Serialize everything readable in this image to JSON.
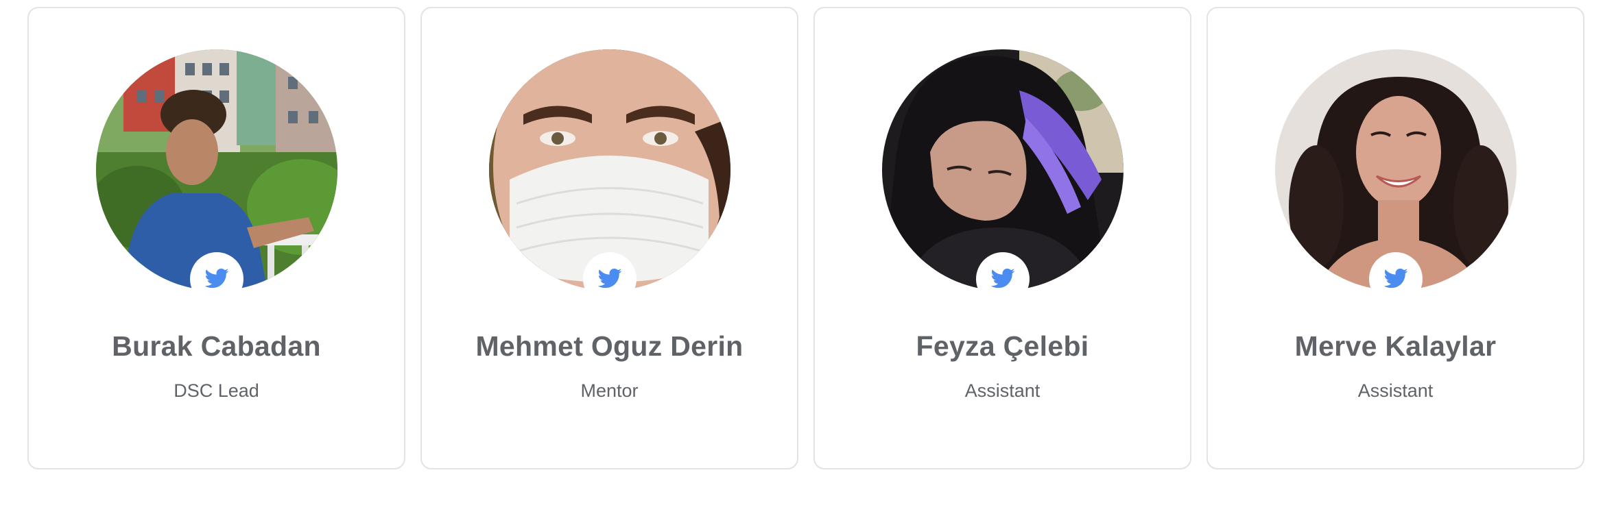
{
  "team": {
    "members": [
      {
        "name": "Burak Cabadan",
        "role": "DSC Lead",
        "social_icon": "twitter-icon"
      },
      {
        "name": "Mehmet Oguz Derin",
        "role": "Mentor",
        "social_icon": "twitter-icon"
      },
      {
        "name": "Feyza Çelebi",
        "role": "Assistant",
        "social_icon": "twitter-icon"
      },
      {
        "name": "Merve Kalaylar",
        "role": "Assistant",
        "social_icon": "twitter-icon"
      }
    ]
  },
  "colors": {
    "twitter": "#4a8cf0",
    "text": "#5f6368",
    "card_border": "#e3e3e3"
  }
}
